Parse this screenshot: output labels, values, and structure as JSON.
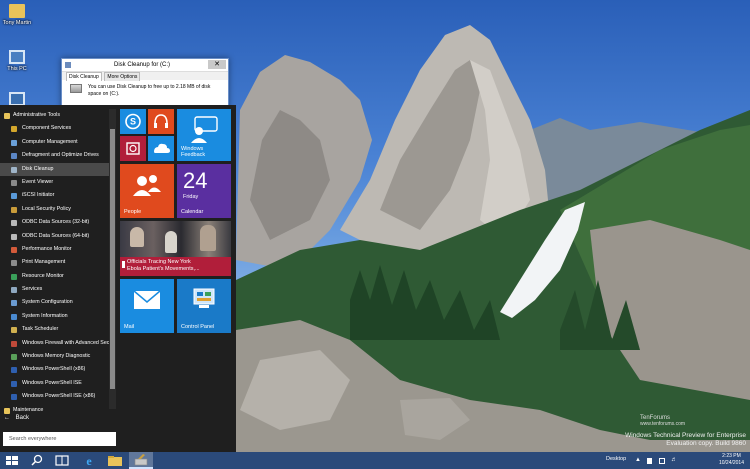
{
  "desktop": {
    "icons": [
      {
        "label": "Tony Martin",
        "icon": "user-folder-icon"
      },
      {
        "label": "This PC",
        "icon": "computer-icon"
      }
    ]
  },
  "disk_cleanup": {
    "title": "Disk Cleanup for  (C:)",
    "close": "✕",
    "tabs": [
      "Disk Cleanup",
      "More Options"
    ],
    "message": "You can use Disk Cleanup to free up to 2.18 MB of disk space on  (C:)."
  },
  "start_menu": {
    "apps": [
      {
        "label": "Administrative Tools",
        "type": "folder",
        "color": "#e8c45a"
      },
      {
        "label": "Component Services",
        "type": "app",
        "color": "#d4a72c"
      },
      {
        "label": "Computer Management",
        "type": "app",
        "color": "#6aa0d8"
      },
      {
        "label": "Defragment and Optimize Drives",
        "type": "app",
        "color": "#5b86c5"
      },
      {
        "label": "Disk Cleanup",
        "type": "app",
        "color": "#9fb4c8",
        "selected": true
      },
      {
        "label": "Event Viewer",
        "type": "app",
        "color": "#8a8a8a"
      },
      {
        "label": "iSCSI Initiator",
        "type": "app",
        "color": "#5a9ad8"
      },
      {
        "label": "Local Security Policy",
        "type": "app",
        "color": "#c99c3a"
      },
      {
        "label": "ODBC Data Sources (32-bit)",
        "type": "app",
        "color": "#b8b8b8"
      },
      {
        "label": "ODBC Data Sources (64-bit)",
        "type": "app",
        "color": "#b8b8b8"
      },
      {
        "label": "Performance Monitor",
        "type": "app",
        "color": "#d25a3a"
      },
      {
        "label": "Print Management",
        "type": "app",
        "color": "#8c8c8c"
      },
      {
        "label": "Resource Monitor",
        "type": "app",
        "color": "#3aa05a"
      },
      {
        "label": "Services",
        "type": "app",
        "color": "#8fa8c0"
      },
      {
        "label": "System Configuration",
        "type": "app",
        "color": "#6a9ad0"
      },
      {
        "label": "System Information",
        "type": "app",
        "color": "#4a8ad0"
      },
      {
        "label": "Task Scheduler",
        "type": "app",
        "color": "#d0b050"
      },
      {
        "label": "Windows Firewall with Advanced Security",
        "type": "app",
        "color": "#c04a3a"
      },
      {
        "label": "Windows Memory Diagnostic",
        "type": "app",
        "color": "#5aa05a"
      },
      {
        "label": "Windows PowerShell (x86)",
        "type": "app",
        "color": "#2f5faf"
      },
      {
        "label": "Windows PowerShell ISE",
        "type": "app",
        "color": "#2f5faf"
      },
      {
        "label": "Windows PowerShell ISE (x86)",
        "type": "app",
        "color": "#2f5faf"
      },
      {
        "label": "Maintenance",
        "type": "folder",
        "color": "#e8c45a"
      }
    ],
    "back_label": "Back",
    "search_placeholder": "Search everywhere"
  },
  "tiles": {
    "windows_feedback": "Windows Feedback",
    "people": "People",
    "calendar_day_number": "24",
    "calendar_day_name": "Friday",
    "calendar": "Calendar",
    "news_line1": "Officials Tracing New York",
    "news_line2": "Ebola Patient's Movements,...",
    "mail": "Mail",
    "control_panel": "Control Panel"
  },
  "taskbar": {
    "desktop_label": "Desktop",
    "time": "2:23 PM",
    "date": "10/24/2014"
  },
  "watermark": {
    "line1": "Windows Technical Preview for Enterprise",
    "line2": "Evaluation copy. Build 9860"
  },
  "site_mark": {
    "brand": "TenForums",
    "site": "www.tenforums.com"
  },
  "colors": {
    "tile_blue": "#1a8ce0",
    "tile_orange": "#e04a1e",
    "tile_purple": "#5a2fa0",
    "tile_red": "#b11e3a",
    "tile_teal": "#1a8cd0",
    "tile_control": "#1a7ac8",
    "taskbar": "#2b4a7a",
    "start_bg": "#1f1f1f"
  }
}
